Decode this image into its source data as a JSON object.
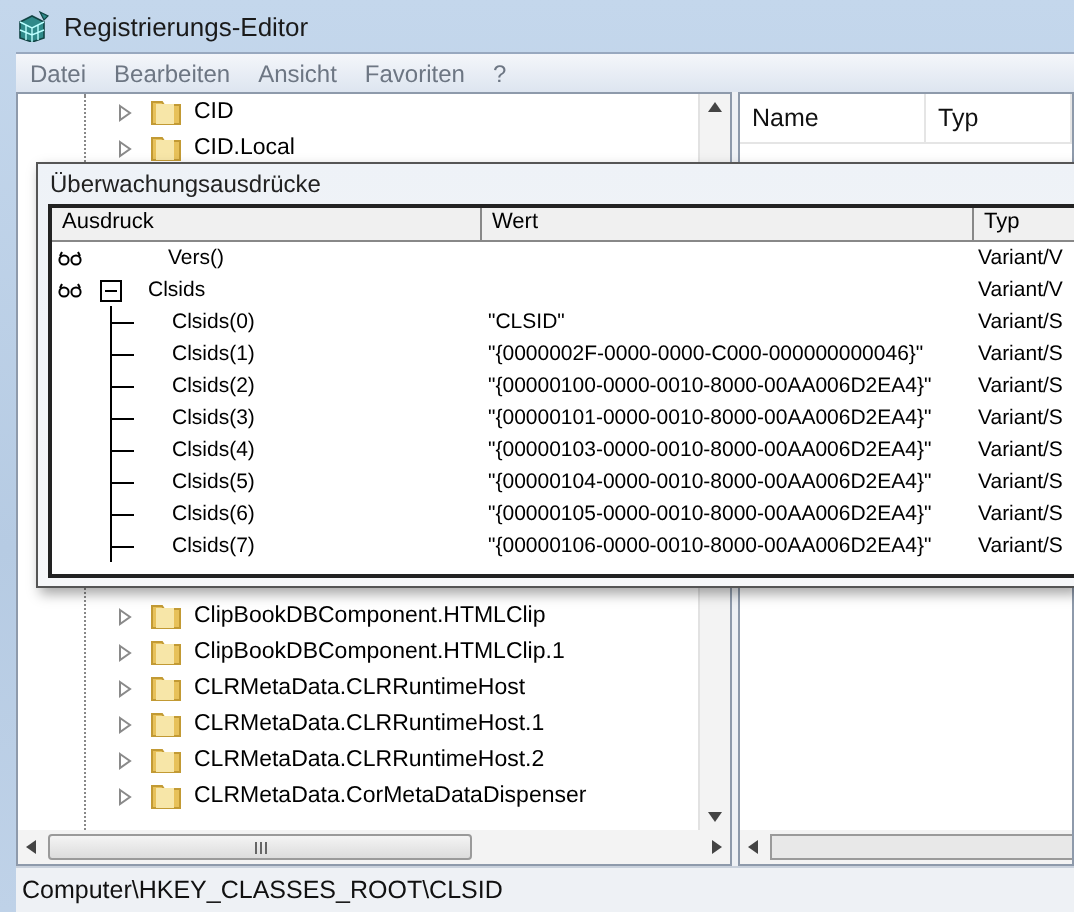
{
  "window": {
    "title": "Registrierungs-Editor"
  },
  "menu": [
    "Datei",
    "Bearbeiten",
    "Ansicht",
    "Favoriten",
    "?"
  ],
  "tree": {
    "items_above": [
      "CID",
      "CID.Local"
    ],
    "items_below": [
      "ClipBookDBComponent.HTMLClip",
      "ClipBookDBComponent.HTMLClip.1",
      "CLRMetaData.CLRRuntimeHost",
      "CLRMetaData.CLRRuntimeHost.1",
      "CLRMetaData.CLRRuntimeHost.2",
      "CLRMetaData.CorMetaDataDispenser"
    ]
  },
  "right_pane": {
    "columns": [
      "Name",
      "Typ"
    ]
  },
  "watch_window": {
    "title": "Überwachungsausdrücke",
    "columns": [
      "Ausdruck",
      "Wert",
      "Typ"
    ],
    "rows": [
      {
        "expression": "Vers()",
        "type": "Variant/V"
      },
      {
        "expression": "Clsids",
        "type": "Variant/V",
        "expanded": true,
        "children": [
          {
            "expression": "Clsids(0)",
            "value": "\"CLSID\"",
            "type": "Variant/S"
          },
          {
            "expression": "Clsids(1)",
            "value": "\"{0000002F-0000-0000-C000-000000000046}\"",
            "type": "Variant/S"
          },
          {
            "expression": "Clsids(2)",
            "value": "\"{00000100-0000-0010-8000-00AA006D2EA4}\"",
            "type": "Variant/S"
          },
          {
            "expression": "Clsids(3)",
            "value": "\"{00000101-0000-0010-8000-00AA006D2EA4}\"",
            "type": "Variant/S"
          },
          {
            "expression": "Clsids(4)",
            "value": "\"{00000103-0000-0010-8000-00AA006D2EA4}\"",
            "type": "Variant/S"
          },
          {
            "expression": "Clsids(5)",
            "value": "\"{00000104-0000-0010-8000-00AA006D2EA4}\"",
            "type": "Variant/S"
          },
          {
            "expression": "Clsids(6)",
            "value": "\"{00000105-0000-0010-8000-00AA006D2EA4}\"",
            "type": "Variant/S"
          },
          {
            "expression": "Clsids(7)",
            "value": "\"{00000106-0000-0010-8000-00AA006D2EA4}\"",
            "type": "Variant/S"
          }
        ]
      }
    ]
  },
  "status_bar": "Computer\\HKEY_CLASSES_ROOT\\CLSID"
}
